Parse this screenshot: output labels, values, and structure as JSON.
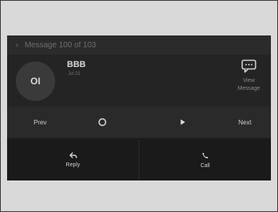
{
  "header": {
    "title": "Message 100 of 103"
  },
  "contact": {
    "initials": "OI",
    "name": "BBB",
    "date": "Jul 31"
  },
  "view_message": {
    "label_line1": "View",
    "label_line2": "Message"
  },
  "controls": {
    "prev_label": "Prev",
    "next_label": "Next"
  },
  "actions": {
    "reply_label": "Reply",
    "call_label": "Call"
  }
}
